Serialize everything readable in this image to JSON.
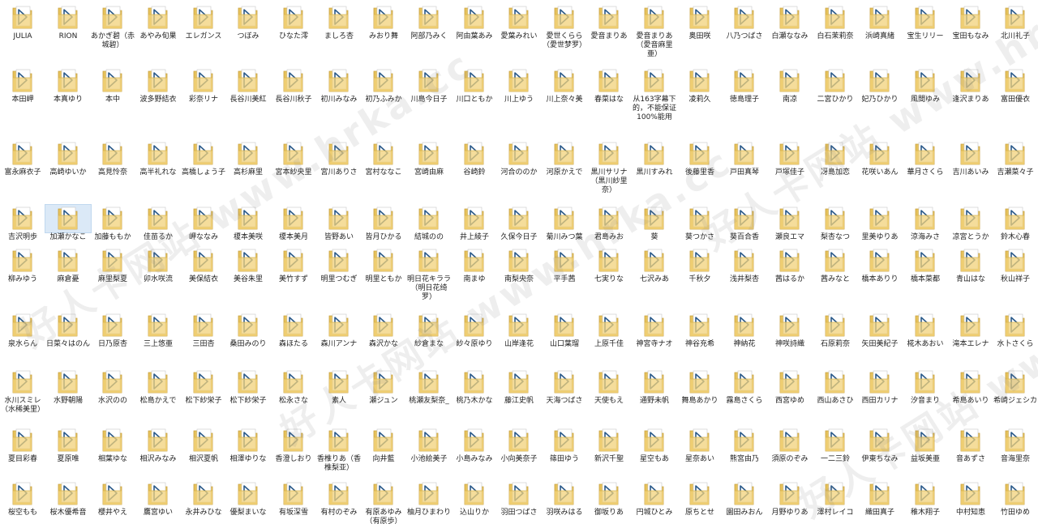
{
  "watermark_text": "好人卡网站 www.hrka.cc",
  "selected_index": 70,
  "folders": [
    "JULIA",
    "RION",
    "あかぎ碧（赤城碧）",
    "あやみ旬果",
    "エレガンス",
    "つぼみ",
    "ひなた澪",
    "ましろ杏",
    "みおり舞",
    "阿部乃みく",
    "阿由葉あみ",
    "愛葉みれい",
    "愛世くらら（愛世梦罗）",
    "愛音まりあ",
    "愛音まりあ（愛音麻里亜）",
    "奥田咲",
    "八乃つばさ",
    "白瀬ななみ",
    "白石茉莉奈",
    "浜崎真緒",
    "宝生リリー",
    "宝田もなみ",
    "北川礼子",
    "本田岬",
    "本真ゆり",
    "本中",
    "波多野結衣",
    "彩奈リナ",
    "長谷川美紅",
    "長谷川秋子",
    "初川みなみ",
    "初乃ふみか",
    "川島今日子",
    "川口ともか",
    "川上ゆう",
    "川上奈々美",
    "春菜はな",
    "从163字幕下的，不能保证100%能用",
    "凌莉久",
    "徳島理子",
    "南凉",
    "二宮ひかり",
    "妃乃ひかり",
    "風間ゆみ",
    "逢沢まりあ",
    "富田優衣",
    "富永麻衣子",
    "高崎ゆいか",
    "高見怜奈",
    "高半礼れな",
    "高橋しょう子",
    "高杉麻里",
    "宮本紗央里",
    "宮川ありさ",
    "宮村ななこ",
    "宮崎由麻",
    "谷崎鈴",
    "河合ののか",
    "河原かえで",
    "黒川サリナ（黒川紗里奈）",
    "黒川すみれ",
    "後藤里香",
    "戸田真琴",
    "戸塚佳子",
    "冴島加恋",
    "花咲いあん",
    "華月さくら",
    "吉川あいみ",
    "吉瀬菜々子",
    "吉沢明歩",
    "加瀬かなこ",
    "加藤ももか",
    "佳苗るか",
    "岬ななみ",
    "榎本美咲",
    "榎本美月",
    "皆野あい",
    "皆月ひかる",
    "結城のの",
    "井上綾子",
    "久保今日子",
    "菊川みつ葉",
    "君島みお",
    "葵",
    "葵つかさ",
    "葵百合香",
    "瀬良エマ",
    "梨杏なつ",
    "里美ゆりあ",
    "涼海みさ",
    "凉宮とうか",
    "鈴木心春",
    "柳みゆう",
    "麻倉憂",
    "麻里梨夏",
    "卯水咲流",
    "美保結衣",
    "美谷朱里",
    "美竹すず",
    "明里つむぎ",
    "明里ともか",
    "明日花キララ（明日花绮罗）",
    "南まゆ",
    "南梨央奈",
    "平手茜",
    "七実りな",
    "七沢みあ",
    "千秋夕",
    "浅井梨杏",
    "茜はるか",
    "茜みなと",
    "橋本ありり",
    "橋本菜都",
    "青山はな",
    "秋山祥子",
    "泉水らん",
    "日菜々はのん",
    "日乃原杏",
    "三上悠亜",
    "三田杏",
    "桑田みのり",
    "森ほたる",
    "森川アンナ",
    "森沢かな",
    "紗倉まな",
    "紗々原ゆり",
    "山岸逢花",
    "山口葉瑠",
    "上原千佳",
    "神宮寺ナオ",
    "神谷充希",
    "神納花",
    "神咲詩織",
    "石原莉奈",
    "矢田美紀子",
    "椛木あおい",
    "滝本エレナ",
    "水卜さくら",
    "水川スミレ（水稀美里）",
    "水野朝陽",
    "水沢のの",
    "松島かえで",
    "松下紗栄子",
    "松下紗栄子",
    "松永さな",
    "素人",
    "瀬ジュン",
    "桃瀬友梨奈_",
    "桃乃木かな",
    "藤江史帆",
    "天海つばさ",
    "天使もえ",
    "通野未帆",
    "舞島あかり",
    "霧島さくら",
    "西宮ゆめ",
    "西山あさひ",
    "西田カリナ",
    "汐音まり",
    "希島あいり",
    "希崎ジェシカ",
    "夏目彩春",
    "夏原唯",
    "相葉ゆな",
    "相沢みなみ",
    "相沢夏帆",
    "相澤ゆりな",
    "香澄しおり",
    "香椎りあ（香椎梨亚）",
    "向井藍",
    "小池絵美子",
    "小島みなみ",
    "小向美奈子",
    "篠田ゆう",
    "新沢千聖",
    "星空もあ",
    "星奈あい",
    "熊宮由乃",
    "須原のぞみ",
    "一二三鈴",
    "伊東ちなみ",
    "益坂美亜",
    "音あずさ",
    "音海里奈",
    "桜空もも",
    "桜木優希音",
    "櫻井やえ",
    "鷹宮ゆい",
    "永井みひな",
    "優梨まいな",
    "有坂深雪",
    "有村のぞみ",
    "有原あゆみ（有原歩）",
    "柚月ひまわり",
    "込山りか",
    "羽田つばさ",
    "羽咲みはる",
    "御坂りあ",
    "円城ひとみ",
    "原ちとせ",
    "園田みおん",
    "月野ゆりあ",
    "澤村レイコ",
    "織田真子",
    "稚木翔子",
    "中村知恵",
    "竹田ゆめ"
  ]
}
